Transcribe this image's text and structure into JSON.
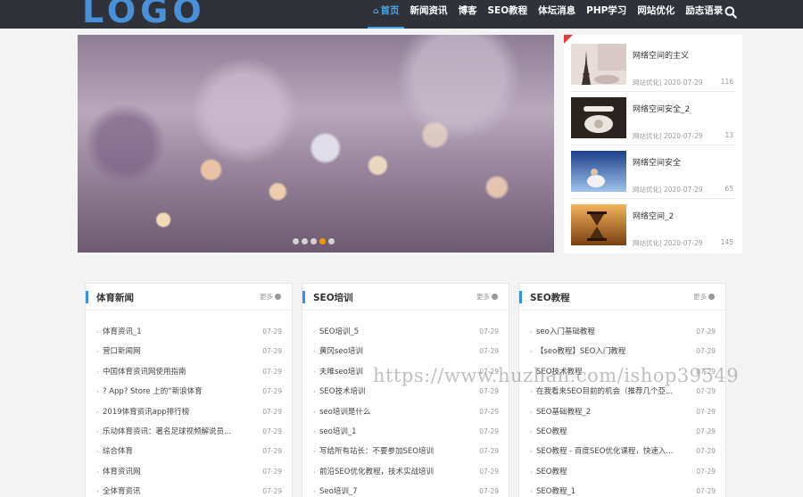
{
  "header": {
    "logo": "LOGO",
    "home_glyph": "⌂",
    "nav": [
      "首页",
      "新闻资讯",
      "博客",
      "SEO教程",
      "体坛消息",
      "PHP学习",
      "网站优化",
      "励志语录"
    ]
  },
  "slider": {
    "slide_count": 5,
    "active_slide": 4
  },
  "side_list": {
    "items": [
      {
        "title": "网络空间的主义",
        "category": "网站优化",
        "date": "2020-07-29",
        "views": "116",
        "thumb": "eiffel-tower-image"
      },
      {
        "title": "网络空间安全_2",
        "category": "网站优化",
        "date": "2020-07-29",
        "views": "13",
        "thumb": "vintage-telephone-image"
      },
      {
        "title": "网络空间安全",
        "category": "网站优化",
        "date": "2020-07-29",
        "views": "65",
        "thumb": "girl-blue-sky-image"
      },
      {
        "title": "网络空间_2",
        "category": "网站优化",
        "date": "2020-07-29",
        "views": "145",
        "thumb": "hourglass-sunset-image"
      }
    ]
  },
  "columns": [
    {
      "title": "体育新闻",
      "more": "更多",
      "rows": [
        {
          "title": "体育资讯_1",
          "date": "07-29"
        },
        {
          "title": "营口新闻网",
          "date": "07-29"
        },
        {
          "title": "中国体育资讯网使用指南",
          "date": "07-29"
        },
        {
          "title": "? App? Store 上的“新浪体育",
          "date": "07-29"
        },
        {
          "title": "2019体育资讯app排行榜",
          "date": "07-29"
        },
        {
          "title": "乐动体育资讯：著名足球视频解说员...",
          "date": "07-29"
        },
        {
          "title": "综合体育",
          "date": "07-29"
        },
        {
          "title": "体育资讯网",
          "date": "07-29"
        },
        {
          "title": "全体育资讯",
          "date": "07-29"
        }
      ]
    },
    {
      "title": "SEO培训",
      "more": "更多",
      "rows": [
        {
          "title": "SEO培训_5",
          "date": "07-29"
        },
        {
          "title": "黄冈seo培训",
          "date": "07-29"
        },
        {
          "title": "夫唯seo培训",
          "date": "07-29"
        },
        {
          "title": "SEO技术培训",
          "date": "07-29"
        },
        {
          "title": "seo培训是什么",
          "date": "07-29"
        },
        {
          "title": "seo培训_1",
          "date": "07-29"
        },
        {
          "title": "写给所有站长：不要参加SEO培训",
          "date": "07-29"
        },
        {
          "title": "前沿SEO优化教程，技术实战培训",
          "date": "07-29"
        },
        {
          "title": "Seo培训_7",
          "date": "07-29"
        }
      ]
    },
    {
      "title": "SEO教程",
      "more": "更多",
      "rows": [
        {
          "title": "seo入门基础教程",
          "date": "07-29"
        },
        {
          "title": "【seo教程】SEO入门教程",
          "date": "07-29"
        },
        {
          "title": "SEO技术教程",
          "date": "07-29"
        },
        {
          "title": "在我看来SEO目前的机会（推荐几个亞...",
          "date": "07-29"
        },
        {
          "title": "SEO基础教程_2",
          "date": "07-29"
        },
        {
          "title": "SEO教程",
          "date": "07-29"
        },
        {
          "title": "SEO教程 - 百度SEO优化课程，快速入...",
          "date": "07-29"
        },
        {
          "title": "SEO教程",
          "date": "07-29"
        },
        {
          "title": "SEO教程_1",
          "date": "07-29"
        }
      ]
    }
  ],
  "watermark": "https://www.huzhan.com/ishop39549",
  "colors": {
    "header_bg": "#2f3339",
    "accent": "#4aa3e8",
    "logo": "#4a90d9",
    "slider_active_dot": "#f39800",
    "column_bar": "#3a8ee6"
  }
}
